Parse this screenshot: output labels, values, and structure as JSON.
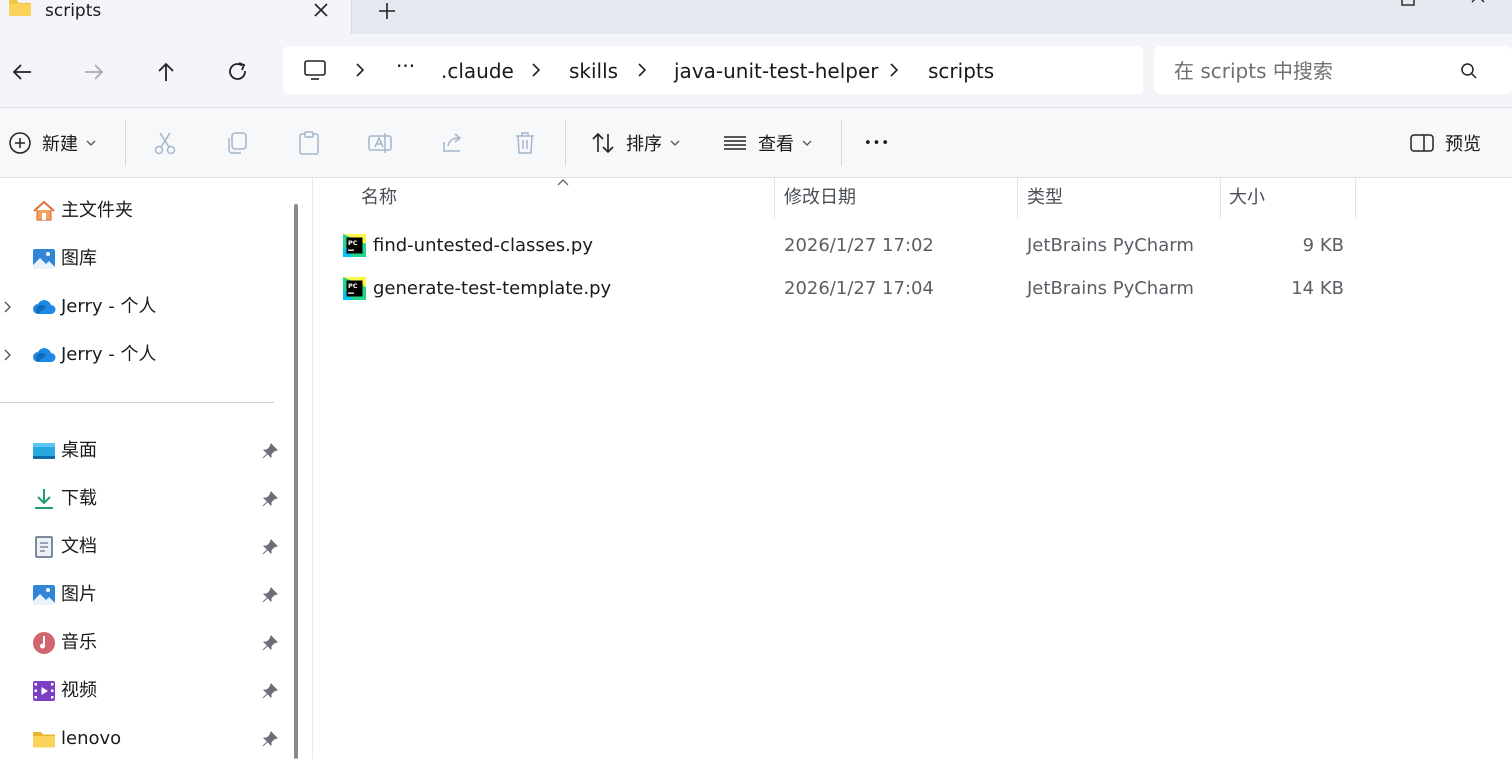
{
  "window": {
    "tab_title": "scripts"
  },
  "nav": {
    "breadcrumb": [
      {
        "label": "···"
      },
      {
        "label": ".claude"
      },
      {
        "label": "skills"
      },
      {
        "label": "java-unit-test-helper"
      },
      {
        "label": "scripts"
      }
    ],
    "search_placeholder": "在 scripts 中搜索"
  },
  "toolbar": {
    "new_label": "新建",
    "sort_label": "排序",
    "view_label": "查看",
    "more_label": "•••",
    "preview_label": "预览"
  },
  "sidebar": {
    "top_items": [
      {
        "label": "主文件夹",
        "icon": "home-icon"
      },
      {
        "label": "图库",
        "icon": "gallery-icon"
      },
      {
        "label": "Jerry - 个人",
        "icon": "onedrive-cloud-icon",
        "expandable": true
      },
      {
        "label": "Jerry - 个人",
        "icon": "onedrive-cloud-icon",
        "expandable": true
      }
    ],
    "pinned_items": [
      {
        "label": "桌面",
        "icon": "desktop-icon"
      },
      {
        "label": "下载",
        "icon": "download-icon"
      },
      {
        "label": "文档",
        "icon": "documents-icon"
      },
      {
        "label": "图片",
        "icon": "pictures-icon"
      },
      {
        "label": "音乐",
        "icon": "music-icon"
      },
      {
        "label": "视频",
        "icon": "videos-icon"
      },
      {
        "label": "lenovo",
        "icon": "folder-icon"
      }
    ]
  },
  "files": {
    "columns": {
      "name": "名称",
      "modified": "修改日期",
      "type": "类型",
      "size": "大小"
    },
    "rows": [
      {
        "name": "find-untested-classes.py",
        "modified": "2026/1/27 17:02",
        "type": "JetBrains PyCharm",
        "size": "9 KB",
        "icon": "pycharm-file-icon"
      },
      {
        "name": "generate-test-template.py",
        "modified": "2026/1/27 17:04",
        "type": "JetBrains PyCharm",
        "size": "14 KB",
        "icon": "pycharm-file-icon"
      }
    ]
  },
  "colors": {
    "accent": "#0067c0",
    "tab_strip": "#e4e8ef",
    "nav_bg": "#f3f5f8",
    "folder_yellow": "#f4c542"
  }
}
